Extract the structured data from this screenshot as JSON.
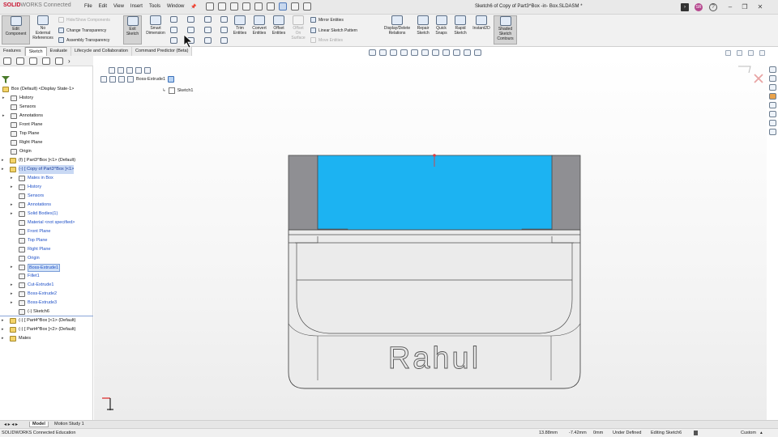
{
  "app": {
    "brand_prefix": "SOLID",
    "brand_suffix": "WORKS Connected",
    "document_title": "Sketch6 of Copy of Part3^Box -in- Box.SLDASM *",
    "menus": [
      "File",
      "Edit",
      "View",
      "Insert",
      "Tools",
      "Window"
    ]
  },
  "commandmanager": {
    "edit_component": "Edit\nComponent",
    "no_external_references": "No\nExternal\nReferences",
    "hide_show_components": "Hide/Show Components",
    "change_transparency": "Change Transparency",
    "assembly_transparency": "Assembly Transparency",
    "exit_sketch": "Exit\nSketch",
    "smart_dimension": "Smart\nDimension",
    "trim_entities": "Trim\nEntities",
    "convert_entities": "Convert\nEntities",
    "offset_entities": "Offset\nEntities",
    "offset_on_surface": "Offset\nOn\nSurface",
    "mirror_entities": "Mirror Entities",
    "linear_sketch_pattern": "Linear Sketch Pattern",
    "move_entities": "Move Entities",
    "display_delete_relations": "Display/Delete\nRelations",
    "repair_sketch": "Repair\nSketch",
    "quick_snaps": "Quick\nSnaps",
    "rapid_sketch": "Rapid\nSketch",
    "instant2d": "Instant2D",
    "shaded_sketch_contours": "Shaded\nSketch\nContours"
  },
  "tabs": [
    "Features",
    "Sketch",
    "Evaluate",
    "Lifecycle and Collaboration",
    "Command Predictor (Beta)"
  ],
  "active_tab": "Sketch",
  "tree": {
    "root": "Box (Default) <Display State-1>",
    "items": [
      {
        "label": "History",
        "level": 1,
        "expander": true
      },
      {
        "label": "Sensors",
        "level": 1,
        "expander": false
      },
      {
        "label": "Annotations",
        "level": 1,
        "expander": true
      },
      {
        "label": "Front Plane",
        "level": 1,
        "expander": false
      },
      {
        "label": "Top Plane",
        "level": 1,
        "expander": false
      },
      {
        "label": "Right Plane",
        "level": 1,
        "expander": false
      },
      {
        "label": "Origin",
        "level": 1,
        "expander": false
      },
      {
        "label": "(f) [ Part3^Box ]<1> (Default)",
        "level": 0,
        "expander": true
      },
      {
        "label": "(-) [ Copy of Part3^Box ]<1>",
        "level": 0,
        "expander": true,
        "state": "highlight"
      },
      {
        "label": "Mates in Box",
        "level": 2,
        "expander": true,
        "state": "child"
      },
      {
        "label": "History",
        "level": 2,
        "expander": true,
        "state": "child"
      },
      {
        "label": "Sensors",
        "level": 2,
        "expander": false,
        "state": "child"
      },
      {
        "label": "Annotations",
        "level": 2,
        "expander": true,
        "state": "child"
      },
      {
        "label": "Solid Bodies(1)",
        "level": 2,
        "expander": true,
        "state": "child"
      },
      {
        "label": "Material <not specified>",
        "level": 2,
        "expander": false,
        "state": "child"
      },
      {
        "label": "Front Plane",
        "level": 2,
        "expander": false,
        "state": "child"
      },
      {
        "label": "Top Plane",
        "level": 2,
        "expander": false,
        "state": "child"
      },
      {
        "label": "Right Plane",
        "level": 2,
        "expander": false,
        "state": "child"
      },
      {
        "label": "Origin",
        "level": 2,
        "expander": false,
        "state": "child"
      },
      {
        "label": "Boss-Extrude1",
        "level": 2,
        "expander": true,
        "state": "selected"
      },
      {
        "label": "Fillet1",
        "level": 2,
        "expander": false,
        "state": "child"
      },
      {
        "label": "Cut-Extrude1",
        "level": 2,
        "expander": true,
        "state": "child"
      },
      {
        "label": "Boss-Extrude2",
        "level": 2,
        "expander": true,
        "state": "child"
      },
      {
        "label": "Boss-Extrude3",
        "level": 2,
        "expander": true,
        "state": "child"
      },
      {
        "label": "(-) Sketch6",
        "level": 2,
        "expander": false,
        "state": "separator"
      },
      {
        "label": "(-) [ Part4^Box ]<1> (Default)",
        "level": 0,
        "expander": true
      },
      {
        "label": "(-) [ Part4^Box ]<2> (Default)",
        "level": 0,
        "expander": true
      },
      {
        "label": "Mates",
        "level": 0,
        "expander": true
      }
    ]
  },
  "viewport": {
    "breadcrumb": "Boss-Extrude1",
    "sketch_node": "Sketch1",
    "engraved_text": "Rahul",
    "highlight_face_color": "#1cb3f2",
    "model_color": "#ebebeb",
    "edge_color": "#4d4d4d"
  },
  "bottom_tabs": [
    "Model",
    "Motion Study 1"
  ],
  "status": {
    "product": "SOLIDWORKS Connected Education",
    "x": "13.88mm",
    "y": "-7.42mm",
    "z": "0mm",
    "state": "Under Defined",
    "editing": "Editing Sketch6",
    "units": "Custom"
  },
  "icons": [
    "search-icon",
    "help-icon",
    "minimize-icon",
    "restore-icon",
    "close-icon",
    "sketch-cursor-icon",
    "origin-axes-icon"
  ]
}
